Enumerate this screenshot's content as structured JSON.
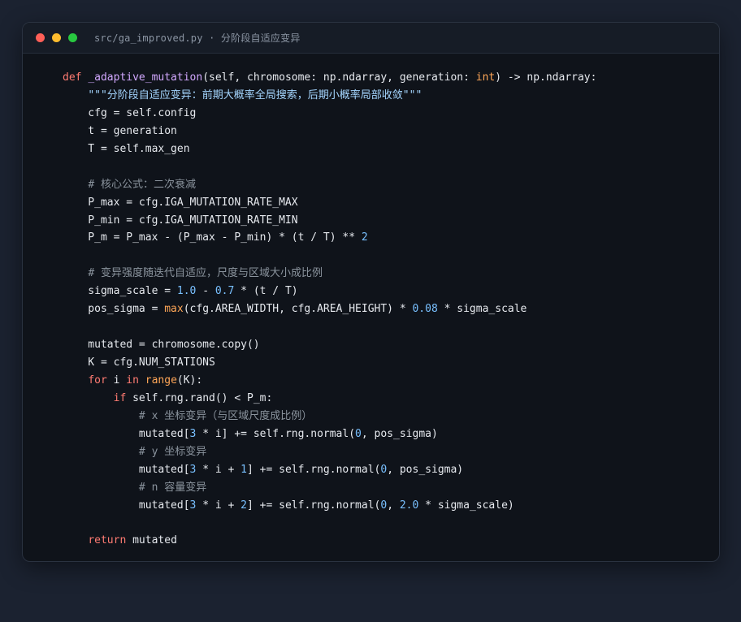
{
  "window": {
    "filename": "src/ga_improved.py · 分阶段自适应变异",
    "colors": {
      "close": "#ff5f57",
      "minimize": "#febc2e",
      "maximize": "#28c840"
    }
  },
  "code": {
    "lines": [
      [
        {
          "c": "kw",
          "t": "def "
        },
        {
          "c": "fn",
          "t": "_adaptive_mutation"
        },
        {
          "t": "(self, chromosome: np.ndarray, generation: "
        },
        {
          "c": "ty",
          "t": "int"
        },
        {
          "t": ") -> np.ndarray:"
        }
      ],
      [
        {
          "t": "    "
        },
        {
          "c": "str",
          "t": "\"\"\"分阶段自适应变异：前期大概率全局搜索，后期小概率局部收敛\"\"\""
        }
      ],
      [
        {
          "t": "    cfg = self.config"
        }
      ],
      [
        {
          "t": "    t = generation"
        }
      ],
      [
        {
          "t": "    T = self.max_gen"
        }
      ],
      [],
      [
        {
          "t": "    "
        },
        {
          "c": "cm",
          "t": "# 核心公式：二次衰减"
        }
      ],
      [
        {
          "t": "    P_max = cfg.IGA_MUTATION_RATE_MAX"
        }
      ],
      [
        {
          "t": "    P_min = cfg.IGA_MUTATION_RATE_MIN"
        }
      ],
      [
        {
          "t": "    P_m = P_max - (P_max - P_min) * (t / T) ** "
        },
        {
          "c": "num",
          "t": "2"
        }
      ],
      [],
      [
        {
          "t": "    "
        },
        {
          "c": "cm",
          "t": "# 变异强度随迭代自适应，尺度与区域大小成比例"
        }
      ],
      [
        {
          "t": "    sigma_scale = "
        },
        {
          "c": "num",
          "t": "1.0"
        },
        {
          "t": " - "
        },
        {
          "c": "num",
          "t": "0.7"
        },
        {
          "t": " * (t / T)"
        }
      ],
      [
        {
          "t": "    pos_sigma = "
        },
        {
          "c": "bi",
          "t": "max"
        },
        {
          "t": "(cfg.AREA_WIDTH, cfg.AREA_HEIGHT) * "
        },
        {
          "c": "num",
          "t": "0.08"
        },
        {
          "t": " * sigma_scale"
        }
      ],
      [],
      [
        {
          "t": "    mutated = chromosome.copy()"
        }
      ],
      [
        {
          "t": "    K = cfg.NUM_STATIONS"
        }
      ],
      [
        {
          "t": "    "
        },
        {
          "c": "kw",
          "t": "for"
        },
        {
          "t": " i "
        },
        {
          "c": "kw",
          "t": "in"
        },
        {
          "t": " "
        },
        {
          "c": "bi",
          "t": "range"
        },
        {
          "t": "(K):"
        }
      ],
      [
        {
          "t": "        "
        },
        {
          "c": "kw",
          "t": "if"
        },
        {
          "t": " self.rng.rand() < P_m:"
        }
      ],
      [
        {
          "t": "            "
        },
        {
          "c": "cm",
          "t": "# x 坐标变异（与区域尺度成比例）"
        }
      ],
      [
        {
          "t": "            mutated["
        },
        {
          "c": "num",
          "t": "3"
        },
        {
          "t": " * i] += self.rng.normal("
        },
        {
          "c": "num",
          "t": "0"
        },
        {
          "t": ", pos_sigma)"
        }
      ],
      [
        {
          "t": "            "
        },
        {
          "c": "cm",
          "t": "# y 坐标变异"
        }
      ],
      [
        {
          "t": "            mutated["
        },
        {
          "c": "num",
          "t": "3"
        },
        {
          "t": " * i + "
        },
        {
          "c": "num",
          "t": "1"
        },
        {
          "t": "] += self.rng.normal("
        },
        {
          "c": "num",
          "t": "0"
        },
        {
          "t": ", pos_sigma)"
        }
      ],
      [
        {
          "t": "            "
        },
        {
          "c": "cm",
          "t": "# n 容量变异"
        }
      ],
      [
        {
          "t": "            mutated["
        },
        {
          "c": "num",
          "t": "3"
        },
        {
          "t": " * i + "
        },
        {
          "c": "num",
          "t": "2"
        },
        {
          "t": "] += self.rng.normal("
        },
        {
          "c": "num",
          "t": "0"
        },
        {
          "t": ", "
        },
        {
          "c": "num",
          "t": "2.0"
        },
        {
          "t": " * sigma_scale)"
        }
      ],
      [],
      [
        {
          "t": "    "
        },
        {
          "c": "kw",
          "t": "return"
        },
        {
          "t": " mutated"
        }
      ]
    ]
  }
}
